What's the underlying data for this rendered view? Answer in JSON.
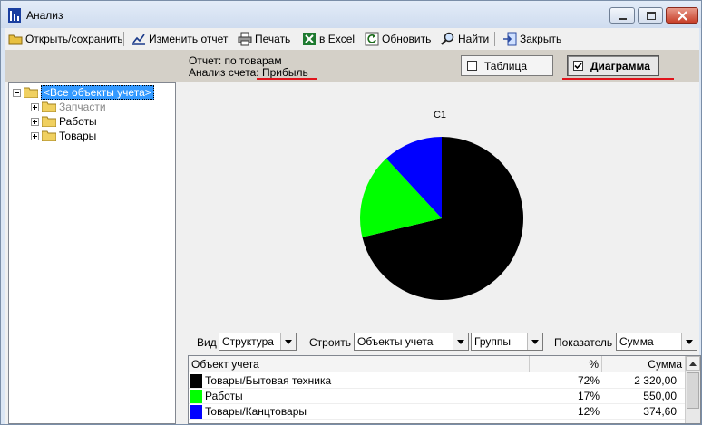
{
  "window": {
    "title": "Анализ"
  },
  "toolbar": {
    "open_save": "Открыть/сохранить",
    "edit_report": "Изменить отчет",
    "print": "Печать",
    "excel": "в Excel",
    "refresh": "Обновить",
    "find": "Найти",
    "close": "Закрыть"
  },
  "info": {
    "report_label": "Отчет:",
    "report_value": "по товарам",
    "analysis_label": "Анализ счета:",
    "analysis_value": "Прибыль"
  },
  "view_toggle": {
    "table_label": "Таблица",
    "table_checked": false,
    "chart_label": "Диаграмма",
    "chart_checked": true
  },
  "tree": {
    "root": "<Все объекты учета>",
    "children": [
      "Запчасти",
      "Работы",
      "Товары"
    ]
  },
  "chart_data": {
    "type": "pie",
    "title": "C1",
    "categories": [
      "Товары/Бытовая техника",
      "Работы",
      "Товары/Канцтовары"
    ],
    "values": [
      72,
      17,
      12
    ],
    "colors": [
      "#000000",
      "#00ff00",
      "#0000ff"
    ]
  },
  "controls": {
    "view_label": "Вид",
    "view_value": "Структура",
    "build_label": "Строить",
    "build_value": "Объекты учета",
    "group_value": "Группы",
    "indicator_label": "Показатель",
    "indicator_value": "Сумма"
  },
  "grid": {
    "headers": [
      "Объект учета",
      "%",
      "Сумма"
    ],
    "rows": [
      {
        "color": "#000000",
        "name": "Товары/Бытовая техника",
        "pct": "72%",
        "sum": "2 320,00"
      },
      {
        "color": "#00ff00",
        "name": "Работы",
        "pct": "17%",
        "sum": "550,00"
      },
      {
        "color": "#0000ff",
        "name": "Товары/Канцтовары",
        "pct": "12%",
        "sum": "374,60"
      }
    ]
  }
}
